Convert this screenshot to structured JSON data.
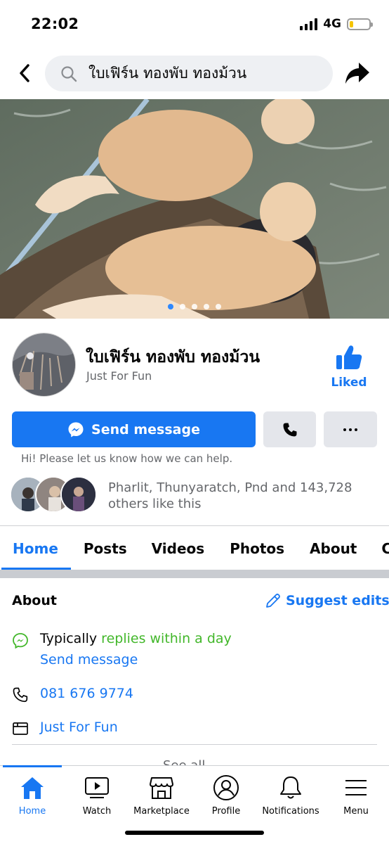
{
  "status_bar": {
    "time": "22:02",
    "network": "4G"
  },
  "search": {
    "query": "ใบเฟิร์น ทองพับ ทองม้วน"
  },
  "cover": {
    "carousel_count": 5,
    "carousel_active": 0
  },
  "page": {
    "name": "ใบเฟิร์น ทองพับ ทองม้วน",
    "category": "Just For Fun",
    "liked_label": "Liked"
  },
  "actions": {
    "send_message_label": "Send message",
    "greeting": "Hi! Please let us know how we can help."
  },
  "likes": {
    "text": "Pharlit, Thunyaratch, Pnd and 143,728 others like this"
  },
  "tabs": [
    {
      "label": "Home",
      "active": true
    },
    {
      "label": "Posts"
    },
    {
      "label": "Videos"
    },
    {
      "label": "Photos"
    },
    {
      "label": "About"
    },
    {
      "label": "Com"
    }
  ],
  "about": {
    "title": "About",
    "suggest_edits": "Suggest edits",
    "response_prefix": "Typically",
    "response_time": "replies within a day",
    "send_message_link": "Send message",
    "phone": "081 676 9774",
    "category": "Just For Fun",
    "see_all": "See all"
  },
  "nav": [
    {
      "label": "Home",
      "icon": "home-icon",
      "active": true
    },
    {
      "label": "Watch",
      "icon": "watch-icon"
    },
    {
      "label": "Marketplace",
      "icon": "marketplace-icon"
    },
    {
      "label": "Profile",
      "icon": "profile-icon"
    },
    {
      "label": "Notifications",
      "icon": "bell-icon"
    },
    {
      "label": "Menu",
      "icon": "menu-icon"
    }
  ],
  "colors": {
    "accent": "#1877f2",
    "response_green": "#42b72a",
    "secondary_text": "#65676b",
    "button_gray": "#e4e6eb"
  }
}
